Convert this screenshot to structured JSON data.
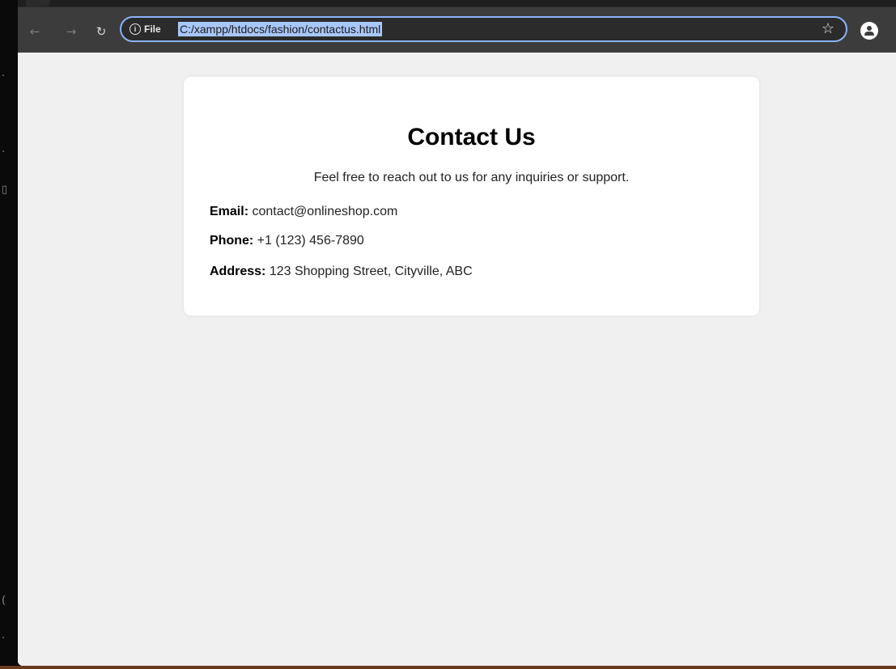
{
  "browser": {
    "site_chip_label": "File",
    "url": "C:/xampp/htdocs/fashion/contactus.html",
    "icons": {
      "back": "arrow-left-icon",
      "forward": "arrow-right-icon",
      "reload": "reload-icon",
      "info": "info-icon",
      "bookmark": "star-icon",
      "profile": "profile-icon"
    },
    "colors": {
      "toolbar": "#3c3c3c",
      "omnibox_border": "#8ab4f8",
      "url_selection": "#a8c7fa"
    }
  },
  "page": {
    "title": "Contact Us",
    "intro": "Feel free to reach out to us for any inquiries or support.",
    "email_label": "Email:",
    "email_value": "contact@onlineshop.com",
    "phone_label": "Phone:",
    "phone_value": "+1 (123) 456-7890",
    "address_label": "Address:",
    "address_value": "123 Shopping Street, Cityville, ABC",
    "colors": {
      "background": "#f0f0f0",
      "card": "#ffffff"
    }
  }
}
